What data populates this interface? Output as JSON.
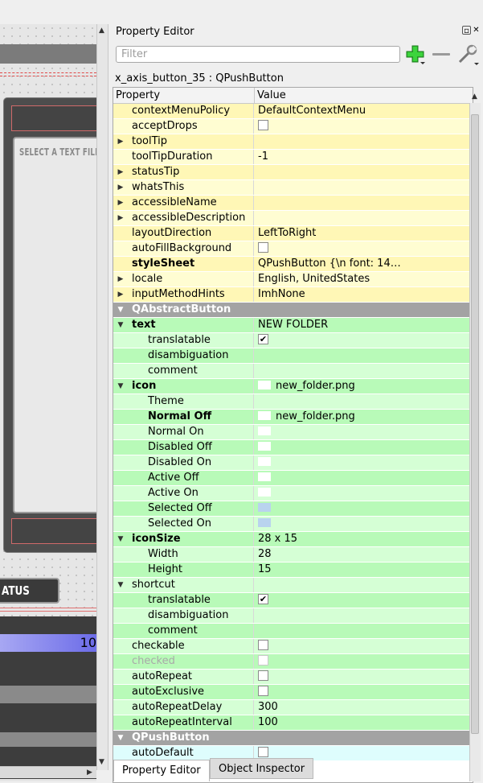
{
  "canvas": {
    "panel_text": "SELECT A TEXT FILE",
    "status_button": "ATUS",
    "gradient_number": "10"
  },
  "dock": {
    "title": "Property Editor",
    "float_icon": "float-icon",
    "close_icon": "close-icon"
  },
  "filter": {
    "placeholder": "Filter",
    "value": ""
  },
  "toolbar": {
    "add_icon": "plus-icon",
    "remove_icon": "minus-icon",
    "config_icon": "wrench-icon"
  },
  "object_line": "x_axis_button_35 : QPushButton",
  "table": {
    "headers": {
      "property": "Property",
      "value": "Value"
    },
    "rows": [
      {
        "name": "contextMenuPolicy",
        "value": "DefaultContextMenu",
        "bg": "y2",
        "indent": 1,
        "expander": "",
        "kind": "text"
      },
      {
        "name": "acceptDrops",
        "value": "",
        "bg": "y1",
        "indent": 1,
        "expander": "",
        "kind": "check",
        "checked": false
      },
      {
        "name": "toolTip",
        "value": "",
        "bg": "y2",
        "indent": 1,
        "expander": "closed",
        "kind": "text"
      },
      {
        "name": "toolTipDuration",
        "value": "-1",
        "bg": "y1",
        "indent": 1,
        "expander": "",
        "kind": "text"
      },
      {
        "name": "statusTip",
        "value": "",
        "bg": "y2",
        "indent": 1,
        "expander": "closed",
        "kind": "text"
      },
      {
        "name": "whatsThis",
        "value": "",
        "bg": "y1",
        "indent": 1,
        "expander": "closed",
        "kind": "text"
      },
      {
        "name": "accessibleName",
        "value": "",
        "bg": "y2",
        "indent": 1,
        "expander": "closed",
        "kind": "text"
      },
      {
        "name": "accessibleDescription",
        "value": "",
        "bg": "y1",
        "indent": 1,
        "expander": "closed",
        "kind": "text"
      },
      {
        "name": "layoutDirection",
        "value": "LeftToRight",
        "bg": "y2",
        "indent": 1,
        "expander": "",
        "kind": "text"
      },
      {
        "name": "autoFillBackground",
        "value": "",
        "bg": "y1",
        "indent": 1,
        "expander": "",
        "kind": "check",
        "checked": false
      },
      {
        "name": "styleSheet",
        "value": "QPushButton {\\n            font: 14…",
        "bg": "y2",
        "indent": 1,
        "expander": "",
        "kind": "text",
        "bold": true
      },
      {
        "name": "locale",
        "value": "English, UnitedStates",
        "bg": "y1",
        "indent": 1,
        "expander": "closed",
        "kind": "text"
      },
      {
        "name": "inputMethodHints",
        "value": "ImhNone",
        "bg": "y2",
        "indent": 1,
        "expander": "closed",
        "kind": "text"
      },
      {
        "name": "QAbstractButton",
        "value": "",
        "bg": "sect",
        "indent": 1,
        "expander": "open",
        "kind": "section"
      },
      {
        "name": "text",
        "value": "NEW FOLDER",
        "bg": "g2",
        "indent": 1,
        "expander": "open",
        "kind": "text",
        "bold": true
      },
      {
        "name": "translatable",
        "value": "",
        "bg": "g1",
        "indent": 2,
        "expander": "",
        "kind": "check",
        "checked": true
      },
      {
        "name": "disambiguation",
        "value": "",
        "bg": "g2",
        "indent": 2,
        "expander": "",
        "kind": "text"
      },
      {
        "name": "comment",
        "value": "",
        "bg": "g1",
        "indent": 2,
        "expander": "",
        "kind": "text"
      },
      {
        "name": "icon",
        "value": "new_folder.png",
        "bg": "g2",
        "indent": 1,
        "expander": "open",
        "kind": "swatch",
        "bold": true,
        "swatch": "white"
      },
      {
        "name": "Theme",
        "value": "",
        "bg": "g1",
        "indent": 2,
        "expander": "",
        "kind": "text"
      },
      {
        "name": "Normal Off",
        "value": "new_folder.png",
        "bg": "g2",
        "indent": 2,
        "expander": "",
        "kind": "swatch",
        "bold": true,
        "swatch": "white"
      },
      {
        "name": "Normal On",
        "value": "",
        "bg": "g1",
        "indent": 2,
        "expander": "",
        "kind": "swatch",
        "swatch": "white"
      },
      {
        "name": "Disabled Off",
        "value": "",
        "bg": "g2",
        "indent": 2,
        "expander": "",
        "kind": "swatch",
        "swatch": "white"
      },
      {
        "name": "Disabled On",
        "value": "",
        "bg": "g1",
        "indent": 2,
        "expander": "",
        "kind": "swatch",
        "swatch": "white"
      },
      {
        "name": "Active Off",
        "value": "",
        "bg": "g2",
        "indent": 2,
        "expander": "",
        "kind": "swatch",
        "swatch": "white"
      },
      {
        "name": "Active On",
        "value": "",
        "bg": "g1",
        "indent": 2,
        "expander": "",
        "kind": "swatch",
        "swatch": "white"
      },
      {
        "name": "Selected Off",
        "value": "",
        "bg": "g2",
        "indent": 2,
        "expander": "",
        "kind": "swatch",
        "swatch": "blue"
      },
      {
        "name": "Selected On",
        "value": "",
        "bg": "g1",
        "indent": 2,
        "expander": "",
        "kind": "swatch",
        "swatch": "blue"
      },
      {
        "name": "iconSize",
        "value": "28 x 15",
        "bg": "g2",
        "indent": 1,
        "expander": "open",
        "kind": "text",
        "bold": true
      },
      {
        "name": "Width",
        "value": "28",
        "bg": "g1",
        "indent": 2,
        "expander": "",
        "kind": "text"
      },
      {
        "name": "Height",
        "value": "15",
        "bg": "g2",
        "indent": 2,
        "expander": "",
        "kind": "text"
      },
      {
        "name": "shortcut",
        "value": "",
        "bg": "g1",
        "indent": 1,
        "expander": "open",
        "kind": "text"
      },
      {
        "name": "translatable",
        "value": "",
        "bg": "g2",
        "indent": 2,
        "expander": "",
        "kind": "check",
        "checked": true
      },
      {
        "name": "disambiguation",
        "value": "",
        "bg": "g1",
        "indent": 2,
        "expander": "",
        "kind": "text"
      },
      {
        "name": "comment",
        "value": "",
        "bg": "g2",
        "indent": 2,
        "expander": "",
        "kind": "text"
      },
      {
        "name": "checkable",
        "value": "",
        "bg": "g1",
        "indent": 1,
        "expander": "",
        "kind": "check",
        "checked": false
      },
      {
        "name": "checked",
        "value": "",
        "bg": "g2",
        "indent": 1,
        "expander": "",
        "kind": "check",
        "checked": false,
        "disabled": true
      },
      {
        "name": "autoRepeat",
        "value": "",
        "bg": "g1",
        "indent": 1,
        "expander": "",
        "kind": "check",
        "checked": false
      },
      {
        "name": "autoExclusive",
        "value": "",
        "bg": "g2",
        "indent": 1,
        "expander": "",
        "kind": "check",
        "checked": false
      },
      {
        "name": "autoRepeatDelay",
        "value": "300",
        "bg": "g1",
        "indent": 1,
        "expander": "",
        "kind": "text"
      },
      {
        "name": "autoRepeatInterval",
        "value": "100",
        "bg": "g2",
        "indent": 1,
        "expander": "",
        "kind": "text"
      },
      {
        "name": "QPushButton",
        "value": "",
        "bg": "sect",
        "indent": 1,
        "expander": "open",
        "kind": "section"
      },
      {
        "name": "autoDefault",
        "value": "",
        "bg": "c1",
        "indent": 1,
        "expander": "",
        "kind": "check",
        "checked": false
      }
    ]
  },
  "tabs": [
    {
      "label": "Property Editor",
      "active": true
    },
    {
      "label": "Object Inspector",
      "active": false
    }
  ],
  "colors": {
    "yellow_row": "#fffdd2",
    "yellow_row_alt": "#fff7b6",
    "green_row": "#d5ffd5",
    "green_row_alt": "#b8fab8",
    "section_header": "#a3a3a3",
    "add_icon_green": "#2fb52f"
  }
}
